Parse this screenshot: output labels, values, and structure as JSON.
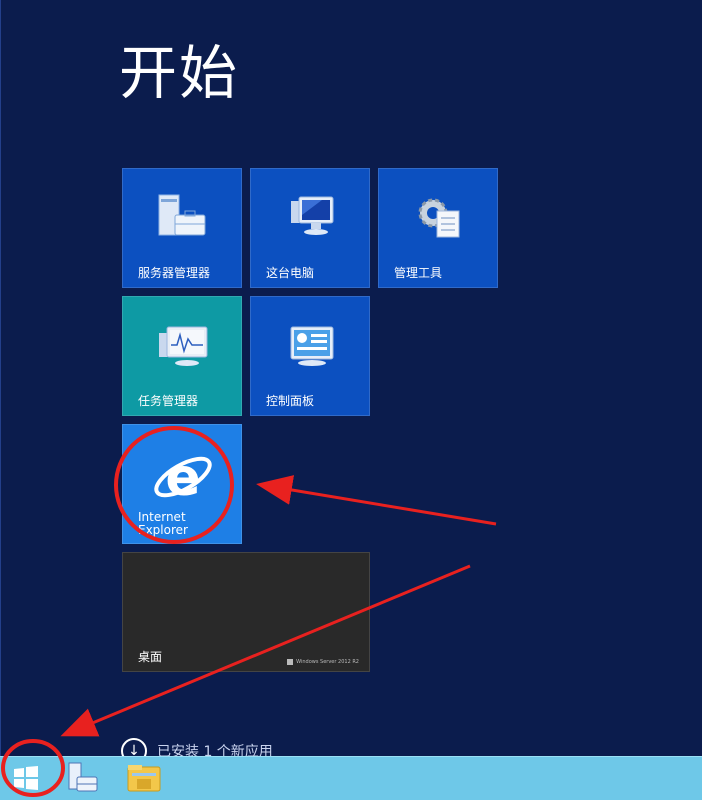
{
  "start": {
    "title": "开始"
  },
  "tiles": [
    {
      "label": "服务器管理器",
      "icon": "server-manager-icon"
    },
    {
      "label": "这台电脑",
      "icon": "this-pc-icon"
    },
    {
      "label": "管理工具",
      "icon": "admin-tools-icon"
    },
    {
      "label": "任务管理器",
      "icon": "task-manager-icon"
    },
    {
      "label": "控制面板",
      "icon": "control-panel-icon"
    },
    {
      "label_line1": "Internet",
      "label_line2": "Explorer",
      "icon": "internet-explorer-icon"
    },
    {
      "label": "桌面",
      "brand": "Windows Server 2012 R2"
    }
  ],
  "notice": {
    "text": "已安装 1 个新应用"
  },
  "taskbar": {
    "items": [
      "windows-start-icon",
      "server-manager-icon",
      "file-explorer-icon"
    ]
  },
  "colors": {
    "background": "#0b1c4d",
    "tile_blue": "#0c50c0",
    "tile_teal": "#0e9aa4",
    "tile_ie": "#1e7fe6",
    "tile_desktop": "#292929",
    "taskbar": "#6ec8e8",
    "annotation": "#e8211f"
  }
}
